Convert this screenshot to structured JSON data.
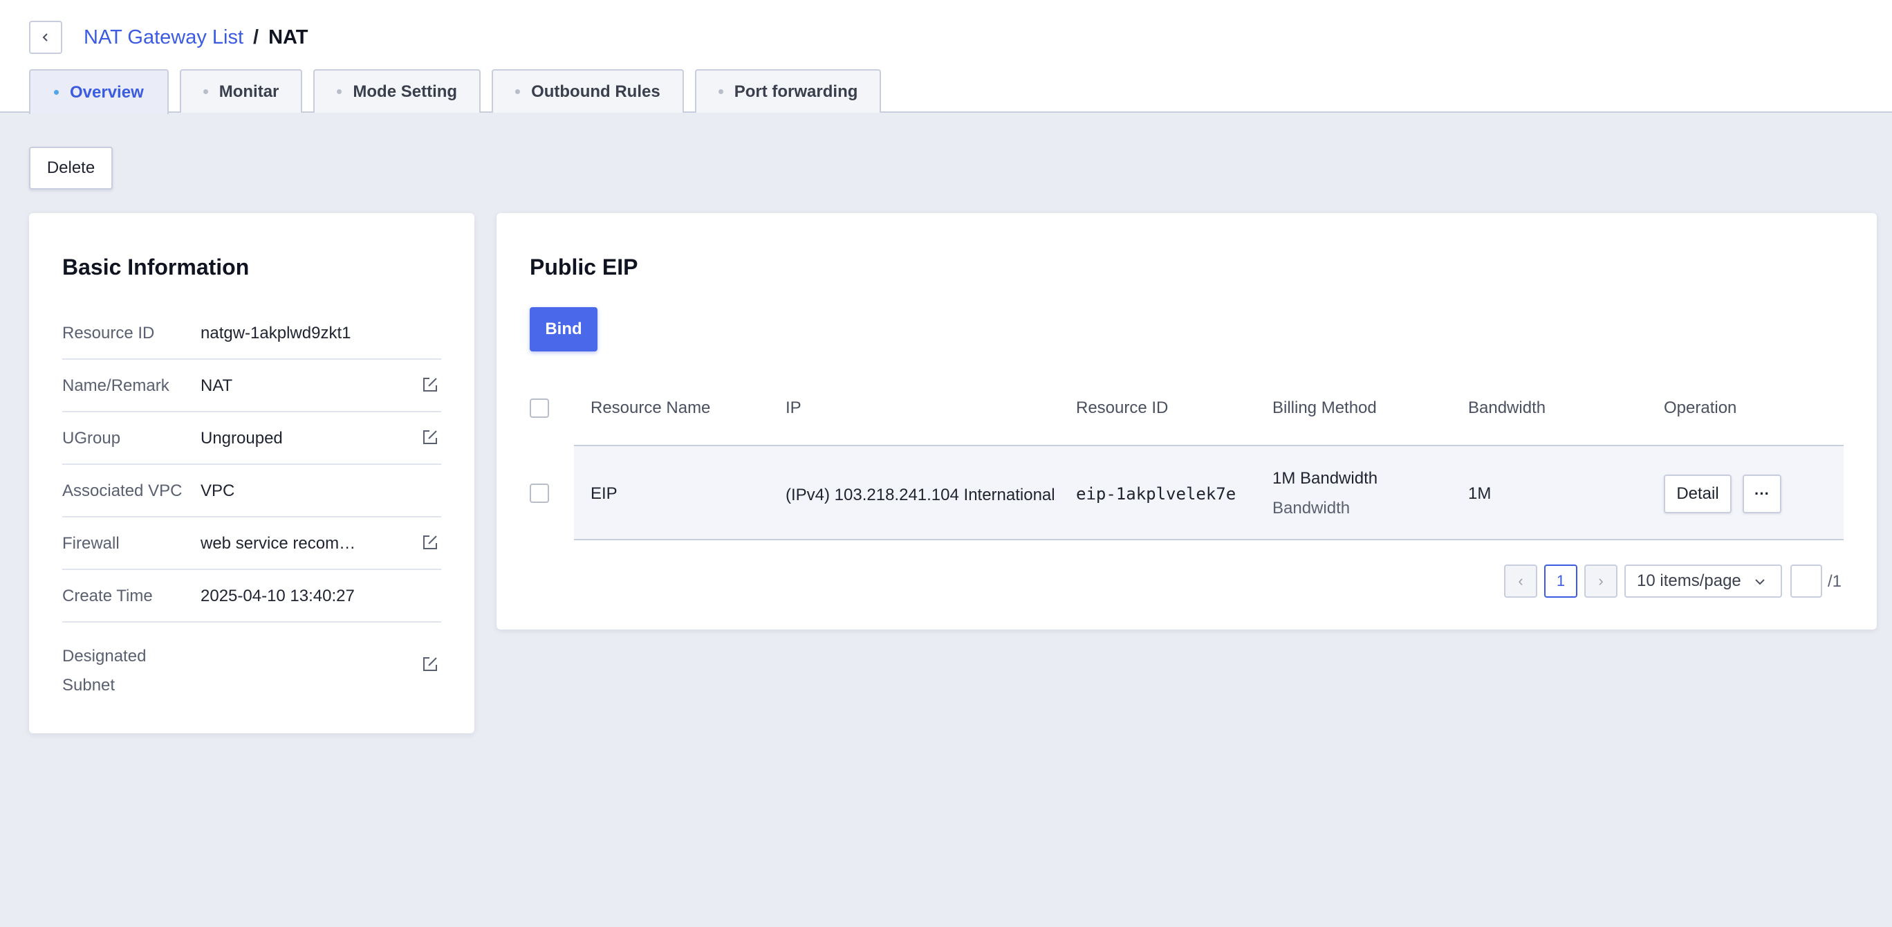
{
  "header": {
    "breadcrumb": {
      "parent": "NAT Gateway List",
      "separator": "/",
      "current": "NAT"
    },
    "tabs": [
      {
        "label": "Overview",
        "active": true
      },
      {
        "label": "Monitar",
        "active": false
      },
      {
        "label": "Mode Setting",
        "active": false
      },
      {
        "label": "Outbound Rules",
        "active": false
      },
      {
        "label": "Port forwarding",
        "active": false
      }
    ]
  },
  "toolbar": {
    "delete_label": "Delete"
  },
  "basic_info": {
    "title": "Basic Information",
    "rows": [
      {
        "label": "Resource ID",
        "value": "natgw-1akplwd9zkt1",
        "editable": false
      },
      {
        "label": "Name/Remark",
        "value": "NAT",
        "editable": true
      },
      {
        "label": "UGroup",
        "value": "Ungrouped",
        "editable": true
      },
      {
        "label": "Associated VPC",
        "value": "VPC",
        "editable": false
      },
      {
        "label": "Firewall",
        "value": "web service recom…",
        "editable": true
      },
      {
        "label": "Create Time",
        "value": "2025-04-10 13:40:27",
        "editable": false
      },
      {
        "label": "Designated Subnet",
        "value": "",
        "editable": true
      }
    ]
  },
  "public_eip": {
    "title": "Public EIP",
    "bind_label": "Bind",
    "columns": [
      "Resource Name",
      "IP",
      "Resource ID",
      "Billing Method",
      "Bandwidth",
      "Operation"
    ],
    "rows": [
      {
        "name": "EIP",
        "ip": "(IPv4) 103.218.241.104 International",
        "resource_id": "eip-1akplvelek7e",
        "billing_line1": "1M Bandwidth",
        "billing_line2": "Bandwidth",
        "bandwidth": "1M",
        "detail_label": "Detail",
        "more_label": "···"
      }
    ],
    "pagination": {
      "prev": "‹",
      "current_page": "1",
      "next": "›",
      "page_size": "10 items/page",
      "total_pages": "/1"
    }
  },
  "colors": {
    "accent": "#4a69ea",
    "link": "#3b5ce0",
    "background": "#eaecf4"
  }
}
